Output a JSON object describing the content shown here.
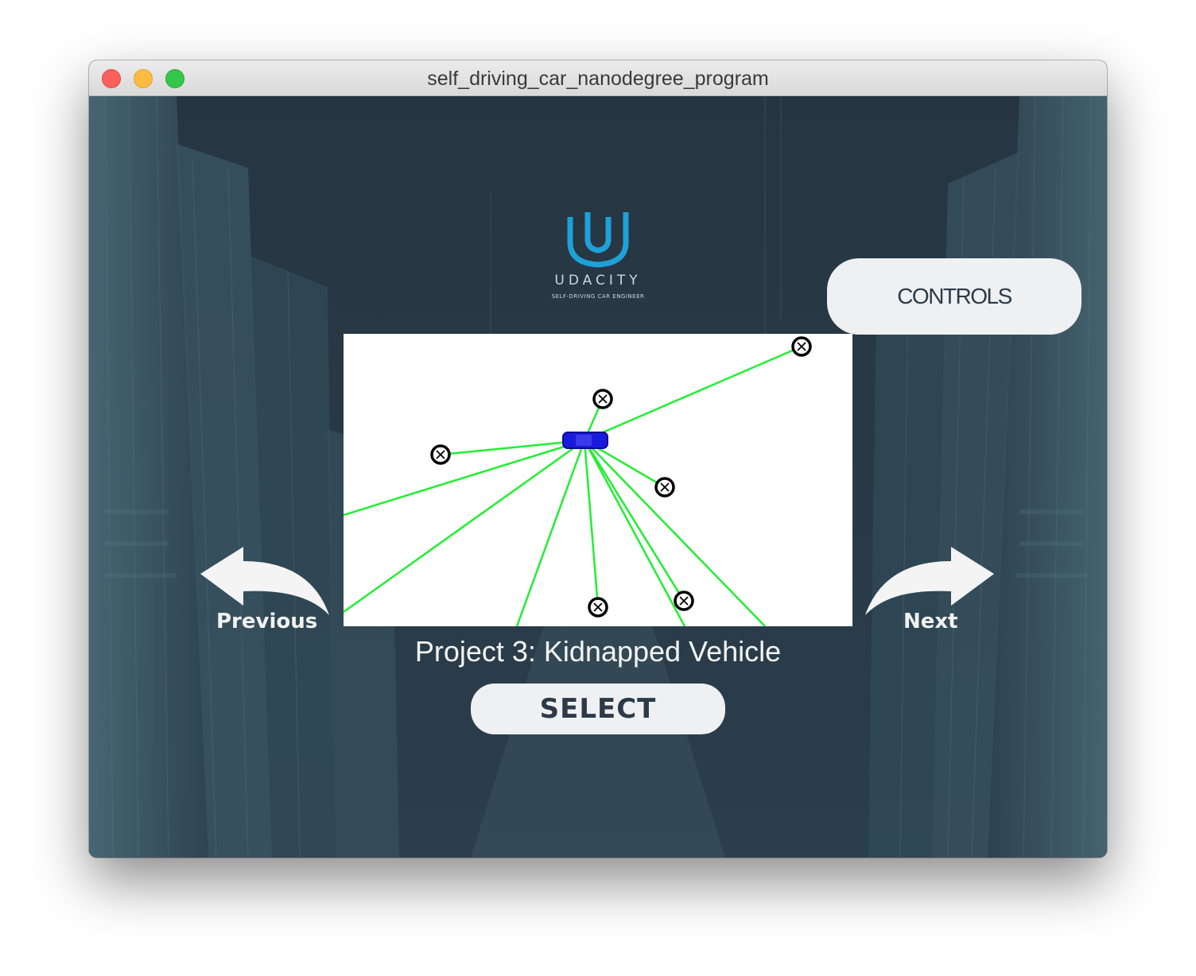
{
  "window": {
    "title": "self_driving_car_nanodegree_program"
  },
  "logo": {
    "wordmark": "UDACITY",
    "tagline": "SELF-DRIVING CAR ENGINEER",
    "icon": "udacity-u-logo",
    "color": "#1ea1d8"
  },
  "controls_button": {
    "label": "CONTROLS"
  },
  "navigation": {
    "previous_label": "Previous",
    "next_label": "Next",
    "previous_icon": "curved-arrow-left-icon",
    "next_icon": "curved-arrow-right-icon"
  },
  "project": {
    "title": "Project 3: Kidnapped Vehicle"
  },
  "select_button": {
    "label": "SELECT"
  },
  "visualization": {
    "vehicle_color": "#1a1adf",
    "ray_color": "#22ee33",
    "landmark_icon": "landmark-x-circle-icon",
    "landmark_count": 6
  },
  "colors": {
    "background": "#243340",
    "button_bg": "#eef0f2",
    "button_text": "#2c3a48"
  }
}
